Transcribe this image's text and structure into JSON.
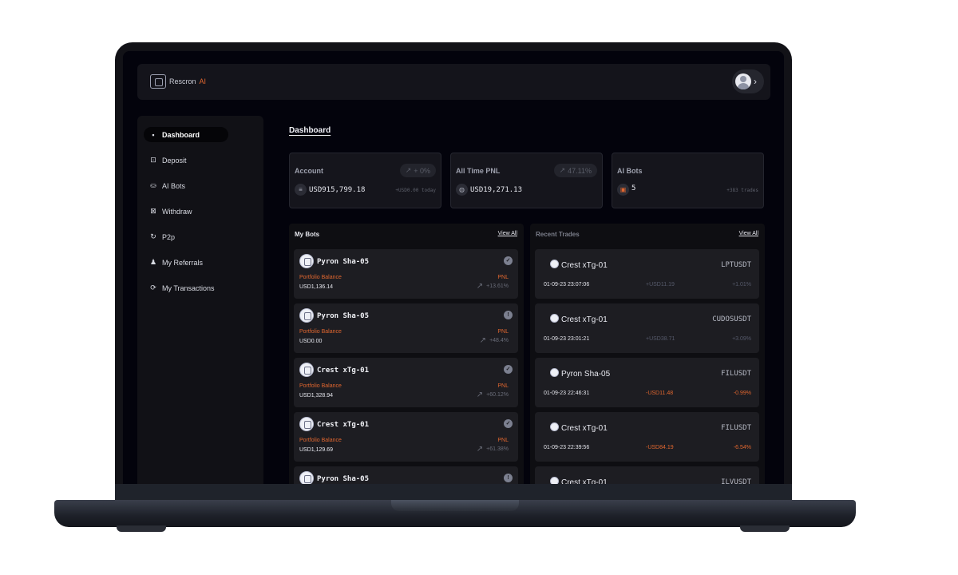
{
  "app": {
    "logo_text": "Rescron",
    "logo_ai": "AI"
  },
  "header": {
    "chevron": "›"
  },
  "sidebar": {
    "items": [
      {
        "label": "Dashboard",
        "icon": "grid-icon",
        "glyph": "▪▪",
        "active": true
      },
      {
        "label": "Deposit",
        "icon": "deposit-icon",
        "glyph": "⊡"
      },
      {
        "label": "AI Bots",
        "icon": "robot-icon",
        "glyph": "⛀"
      },
      {
        "label": "Withdraw",
        "icon": "withdraw-icon",
        "glyph": "⊠"
      },
      {
        "label": "P2p",
        "icon": "refresh-icon",
        "glyph": "↻"
      },
      {
        "label": "My Referrals",
        "icon": "users-icon",
        "glyph": "♟"
      },
      {
        "label": "My Transactions",
        "icon": "sync-icon",
        "glyph": "⟳"
      }
    ]
  },
  "main": {
    "title": "Dashboard",
    "stats": {
      "account": {
        "label": "Account",
        "badge": "+ 0%",
        "value": "USD915,799.18",
        "sub": "+USD0.00 today"
      },
      "pnl": {
        "label": "All Time PNL",
        "badge": "47.11%",
        "value": "USD19,271.13"
      },
      "bots": {
        "label": "AI Bots",
        "value": "5",
        "sub": "+383 trades"
      }
    },
    "my_bots": {
      "title": "My Bots",
      "view_all": "View All",
      "pb_label": "Portfolio Balance",
      "pnl_label": "PNL",
      "items": [
        {
          "name": "Pyron Sha-05",
          "status": "✓",
          "balance": "USD1,136.14",
          "pnl": "+13.61%"
        },
        {
          "name": "Pyron Sha-05",
          "status": "!",
          "balance": "USD0.00",
          "pnl": "+48.4%"
        },
        {
          "name": "Crest xTg-01",
          "status": "✓",
          "balance": "USD1,328.94",
          "pnl": "+60.12%"
        },
        {
          "name": "Crest xTg-01",
          "status": "✓",
          "balance": "USD1,129.69",
          "pnl": "+61.38%"
        },
        {
          "name": "Pyron Sha-05",
          "status": "!",
          "balance": "",
          "pnl": ""
        }
      ]
    },
    "recent_trades": {
      "title": "Recent Trades",
      "view_all": "View All",
      "items": [
        {
          "bot": "Crest xTg-01",
          "pair": "LPTUSDT",
          "time": "01-09-23 23:07:06",
          "amount": "+USD11.19",
          "pct": "+1.01%",
          "positive": true
        },
        {
          "bot": "Crest xTg-01",
          "pair": "CUDOSUSDT",
          "time": "01-09-23 23:01:21",
          "amount": "+USD38.71",
          "pct": "+3.09%",
          "positive": true
        },
        {
          "bot": "Pyron Sha-05",
          "pair": "FILUSDT",
          "time": "01-09-23 22:46:31",
          "amount": "-USD11.48",
          "pct": "-0.99%",
          "positive": false
        },
        {
          "bot": "Crest xTg-01",
          "pair": "FILUSDT",
          "time": "01-09-23 22:39:56",
          "amount": "-USD84.19",
          "pct": "-6.54%",
          "positive": false
        },
        {
          "bot": "Crest xTg-01",
          "pair": "ILVUSDT",
          "time": "",
          "amount": "",
          "pct": "",
          "positive": true
        }
      ]
    }
  },
  "colors": {
    "accent": "#e0662f",
    "background": "#03030c",
    "card": "#1d1d22"
  }
}
